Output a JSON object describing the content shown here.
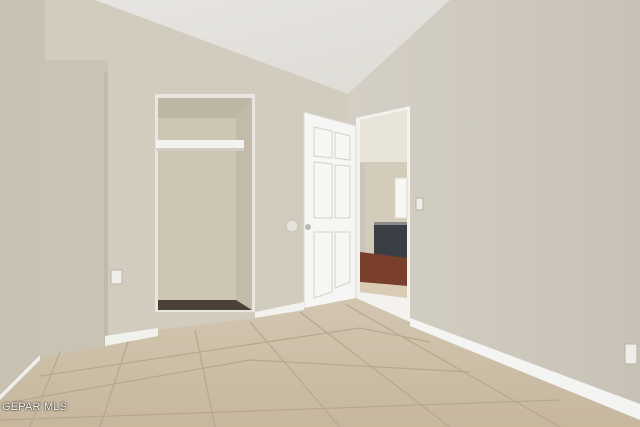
{
  "photo": {
    "watermark": "GEPAR MLS",
    "colors": {
      "wall_left": "#d3cdc0",
      "wall_right": "#cfcabf",
      "ceiling": "#e8e6e2",
      "floor_tile": "#cdbfa7",
      "grout": "#b7a88f",
      "baseboard": "#f4f4f2",
      "door": "#f6f6f4",
      "hallway_floor": "#7a3f2c",
      "cabinet": "#3a3f45"
    }
  }
}
